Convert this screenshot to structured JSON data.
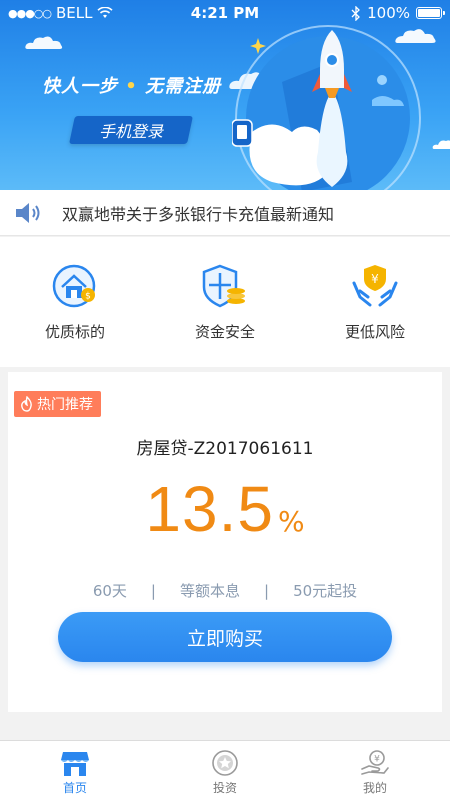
{
  "status_bar": {
    "carrier": "BELL",
    "signal_dots": "●●●○○",
    "time": "4:21 PM",
    "battery": "100%"
  },
  "banner": {
    "slogan_left": "快人一步",
    "slogan_dot": "•",
    "slogan_right": "无需注册",
    "login_button": "手机登录"
  },
  "notice": {
    "icon": "speaker-icon",
    "text": "双赢地带关于多张银行卡充值最新通知"
  },
  "features": [
    {
      "icon": "house-money-icon",
      "label": "优质标的"
    },
    {
      "icon": "shield-coins-icon",
      "label": "资金安全"
    },
    {
      "icon": "hands-shield-icon",
      "label": "更低风险"
    }
  ],
  "product": {
    "tag": "热门推荐",
    "name": "房屋贷-Z2017061611",
    "rate": "13.5",
    "rate_unit": "%",
    "term": "60天",
    "separator": "|",
    "repayment": "等额本息",
    "min_invest": "50元起投",
    "buy_button": "立即购买"
  },
  "tabbar": {
    "tabs": [
      {
        "icon": "store-icon",
        "label": "首页",
        "active": true
      },
      {
        "icon": "coin-icon",
        "label": "投资",
        "active": false
      },
      {
        "icon": "hand-coin-icon",
        "label": "我的",
        "active": false
      }
    ]
  },
  "colors": {
    "accent_blue": "#2a86ee",
    "rate_orange": "#f08a14",
    "tag_orange": "#ff7d5a"
  }
}
